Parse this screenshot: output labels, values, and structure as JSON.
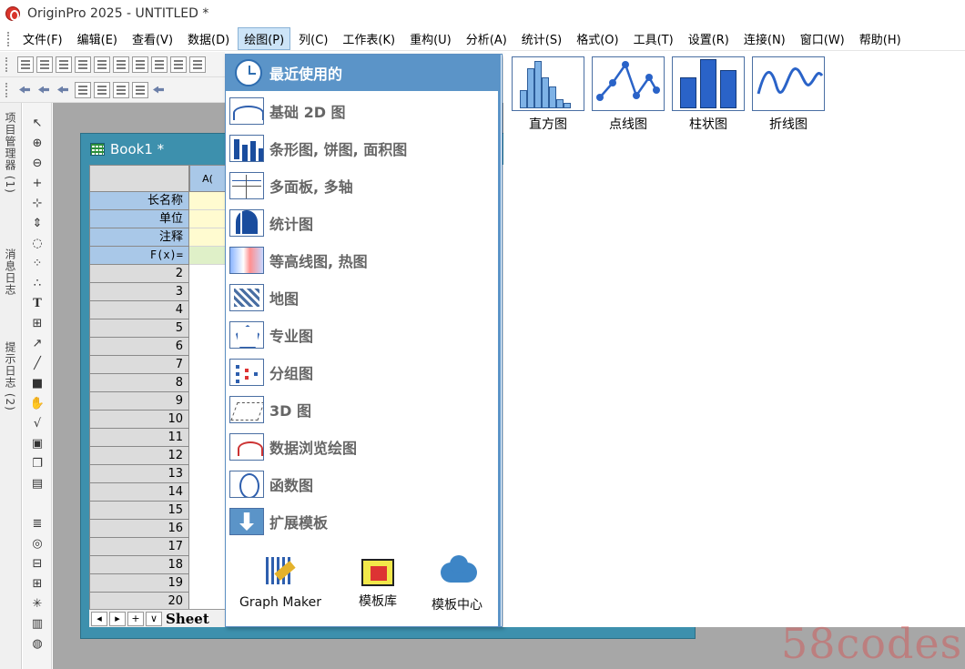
{
  "window": {
    "title": "OriginPro 2025 - UNTITLED *"
  },
  "menu": [
    {
      "label": "文件(F)",
      "active": false
    },
    {
      "label": "编辑(E)",
      "active": false
    },
    {
      "label": "查看(V)",
      "active": false
    },
    {
      "label": "数据(D)",
      "active": false
    },
    {
      "label": "绘图(P)",
      "active": true
    },
    {
      "label": "列(C)",
      "active": false
    },
    {
      "label": "工作表(K)",
      "active": false
    },
    {
      "label": "重构(U)",
      "active": false
    },
    {
      "label": "分析(A)",
      "active": false
    },
    {
      "label": "统计(S)",
      "active": false
    },
    {
      "label": "格式(O)",
      "active": false
    },
    {
      "label": "工具(T)",
      "active": false
    },
    {
      "label": "设置(R)",
      "active": false
    },
    {
      "label": "连接(N)",
      "active": false
    },
    {
      "label": "窗口(W)",
      "active": false
    },
    {
      "label": "帮助(H)",
      "active": false
    }
  ],
  "side_tabs": [
    "项目管理器 (1)",
    "消息日志",
    "提示日志 (2)"
  ],
  "workbook": {
    "title": "Book1 *",
    "column_a": "A(",
    "row_labels": [
      "长名称",
      "单位",
      "注释",
      "F(x)="
    ],
    "row_numbers": [
      "2",
      "3",
      "4",
      "5",
      "6",
      "7",
      "8",
      "9",
      "10",
      "11",
      "12",
      "13",
      "14",
      "15",
      "16",
      "17",
      "18",
      "19",
      "20"
    ],
    "sheet_tab": "Sheet"
  },
  "graph_menu": {
    "header": "最近使用的",
    "categories": [
      {
        "label": "基础 2D 图",
        "icon": "line-plot-icon"
      },
      {
        "label": "条形图, 饼图, 面积图",
        "icon": "bar-chart-icon"
      },
      {
        "label": "多面板, 多轴",
        "icon": "multi-panel-icon"
      },
      {
        "label": "统计图",
        "icon": "histogram-icon"
      },
      {
        "label": "等高线图, 热图",
        "icon": "contour-icon"
      },
      {
        "label": "地图",
        "icon": "map-icon"
      },
      {
        "label": "专业图",
        "icon": "specialized-icon"
      },
      {
        "label": "分组图",
        "icon": "grouped-icon"
      },
      {
        "label": "3D 图",
        "icon": "3d-plot-icon"
      },
      {
        "label": "数据浏览绘图",
        "icon": "data-explore-icon"
      },
      {
        "label": "函数图",
        "icon": "function-plot-icon"
      },
      {
        "label": "扩展模板",
        "icon": "extend-template-icon"
      }
    ],
    "bottom": [
      {
        "label": "Graph Maker",
        "icon": "graph-maker-icon"
      },
      {
        "label": "模板库",
        "icon": "template-library-icon"
      },
      {
        "label": "模板中心",
        "icon": "cloud-download-icon"
      }
    ]
  },
  "recent": [
    {
      "label": "直方图",
      "icon": "histogram-thumb-icon"
    },
    {
      "label": "点线图",
      "icon": "line-symbol-thumb-icon"
    },
    {
      "label": "柱状图",
      "icon": "column-thumb-icon"
    },
    {
      "label": "折线图",
      "icon": "line-thumb-icon"
    }
  ],
  "watermark": "58codes",
  "colors": {
    "menu_header": "#5b94c8",
    "workbook_frame": "#3d90ad",
    "menu_active": "#cce4f7"
  }
}
